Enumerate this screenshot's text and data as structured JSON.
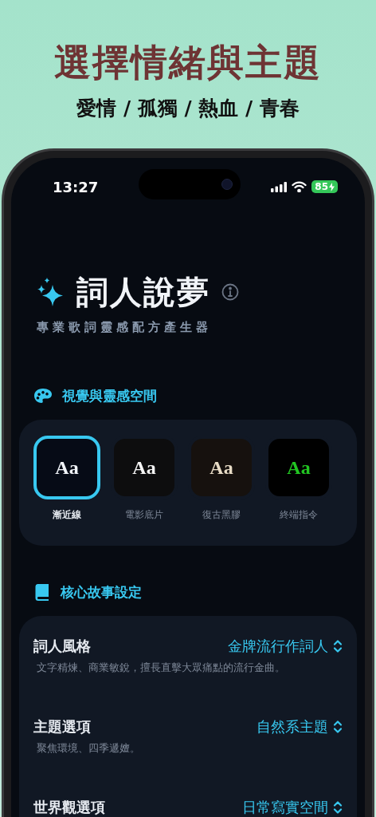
{
  "headline": {
    "title": "選擇情緒與主題",
    "subtitle": "愛情 / 孤獨 / 熱血 / 青春"
  },
  "status_bar": {
    "time": "13:27",
    "battery": "85"
  },
  "app": {
    "title": "詞人說夢",
    "subtitle": "專業歌詞靈感配方產生器"
  },
  "visual_section": {
    "title": "視覺與靈感空間",
    "themes": [
      {
        "label": "漸近線",
        "sample": "Aa",
        "kind": "gradient",
        "color": "#f1f5f9",
        "selected": true
      },
      {
        "label": "電影底片",
        "sample": "Aa",
        "kind": "film",
        "color": "#f5f5f5",
        "selected": false
      },
      {
        "label": "復古黑膠",
        "sample": "Aa",
        "kind": "vinyl",
        "color": "#e8dcc6",
        "selected": false
      },
      {
        "label": "終端指令",
        "sample": "Aa",
        "kind": "terminal",
        "color": "#22c522",
        "selected": false
      }
    ]
  },
  "story_section": {
    "title": "核心故事設定",
    "settings": [
      {
        "label": "詞人風格",
        "value": "金牌流行作詞人",
        "description": "文字精煉、商業敏銳，擅長直擊大眾痛點的流行金曲。"
      },
      {
        "label": "主題選項",
        "value": "自然系主題",
        "description": "聚焦環境、四季遞嬗。"
      },
      {
        "label": "世界觀選項",
        "value": "日常寫實空間"
      }
    ]
  }
}
